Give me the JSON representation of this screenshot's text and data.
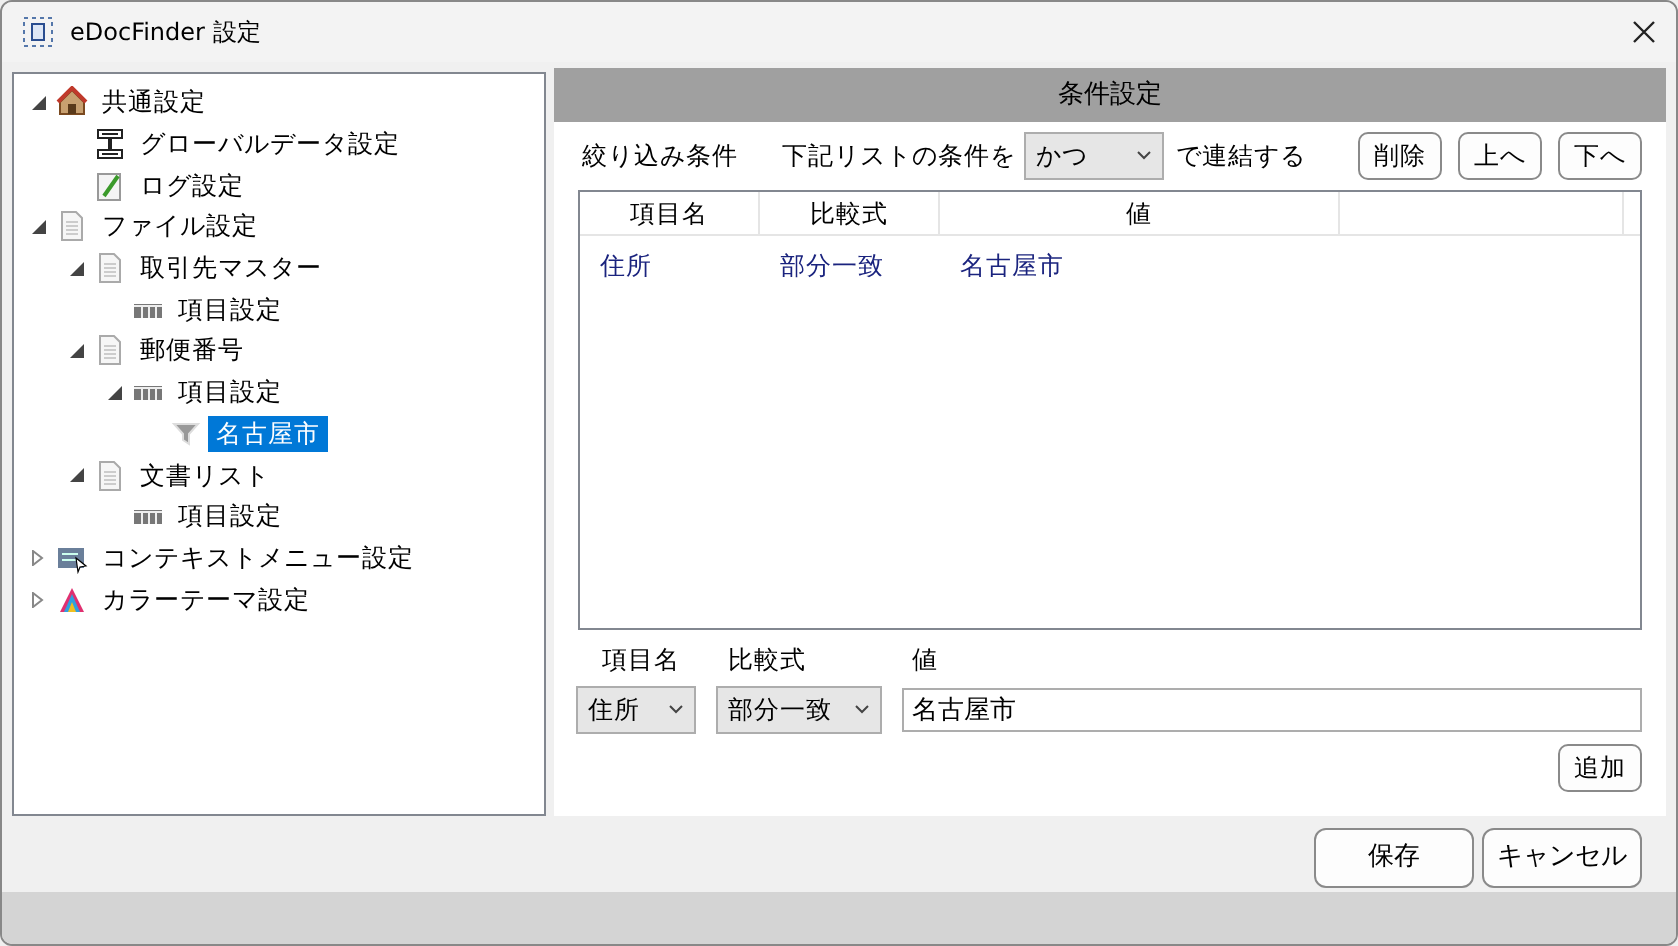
{
  "window": {
    "title": "eDocFinder 設定"
  },
  "tree": [
    {
      "label": "共通設定",
      "kind": "category",
      "expanded": true,
      "selected": false,
      "children": [
        {
          "label": "グローバルデータ設定",
          "kind": "global",
          "selected": false
        },
        {
          "label": "ログ設定",
          "kind": "log",
          "selected": false
        }
      ]
    },
    {
      "label": "ファイル設定",
      "kind": "file",
      "expanded": true,
      "selected": false,
      "children": [
        {
          "label": "取引先マスター",
          "kind": "file",
          "expanded": true,
          "selected": false,
          "children": [
            {
              "label": "項目設定",
              "kind": "fields",
              "selected": false
            }
          ]
        },
        {
          "label": "郵便番号",
          "kind": "file",
          "expanded": true,
          "selected": false,
          "children": [
            {
              "label": "項目設定",
              "kind": "fields",
              "expanded": true,
              "selected": false,
              "children": [
                {
                  "label": "名古屋市",
                  "kind": "filter",
                  "selected": true
                }
              ]
            }
          ]
        },
        {
          "label": "文書リスト",
          "kind": "file",
          "expanded": true,
          "selected": false,
          "children": [
            {
              "label": "項目設定",
              "kind": "fields",
              "selected": false
            }
          ]
        }
      ]
    },
    {
      "label": "コンテキストメニュー設定",
      "kind": "menu",
      "expanded": false,
      "selected": false
    },
    {
      "label": "カラーテーマ設定",
      "kind": "theme",
      "expanded": false,
      "selected": false
    }
  ],
  "panel": {
    "title": "条件設定",
    "filter_label": "絞り込み条件",
    "join_prefix": "下記リストの条件を",
    "join_value": "かつ",
    "join_suffix": "で連結する",
    "buttons": [
      "削除",
      "上へ",
      "下へ"
    ],
    "table": {
      "columns": [
        "項目名",
        "比較式",
        "値"
      ],
      "rows": [
        [
          "住所",
          "部分一致",
          "名古屋市"
        ]
      ]
    },
    "editor": {
      "labels": [
        "項目名",
        "比較式",
        "値"
      ],
      "field_value": "住所",
      "operator_value": "部分一致",
      "value": "名古屋市",
      "add_button": "追加"
    }
  },
  "footer_buttons": [
    "保存",
    "キャンセル"
  ]
}
